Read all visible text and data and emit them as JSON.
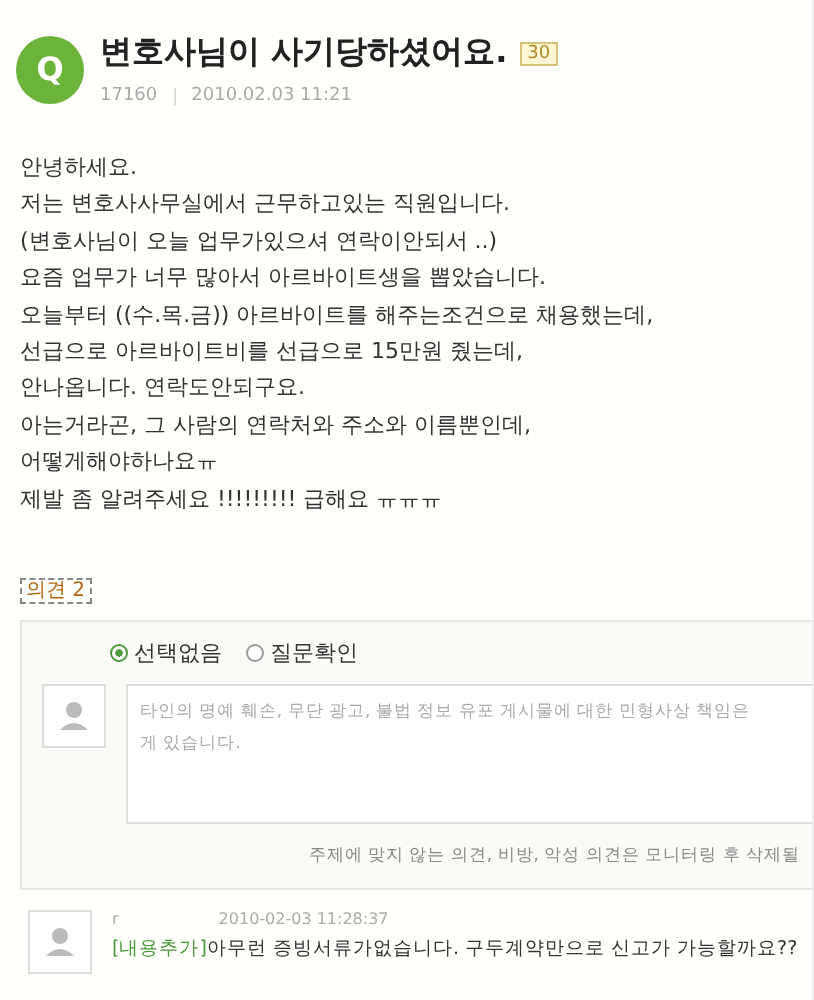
{
  "question": {
    "badge": "Q",
    "title": "변호사님이 사기당하셨어요.",
    "points": "30",
    "author": "17160",
    "date": "2010.02.03 11:21"
  },
  "body": [
    "안녕하세요.",
    "저는 변호사사무실에서 근무하고있는 직원입니다.",
    "(변호사님이 오늘 업무가있으셔 연락이안되서 ..)",
    "요즘 업무가 너무 많아서 아르바이트생을 뽑았습니다.",
    "오늘부터 ((수.목.금)) 아르바이트를 해주는조건으로 채용했는데,",
    "선급으로 아르바이트비를 선급으로 15만원 줬는데,",
    "안나옵니다. 연락도안되구요.",
    "아는거라곤, 그 사람의 연락처와 주소와 이름뿐인데,",
    "어떻게해야하나요ㅠ",
    "제발 좀 알려주세요 !!!!!!!!! 급해요 ㅠㅠㅠ"
  ],
  "comments_heading": "의견 2",
  "comment_form": {
    "options": [
      {
        "label": "선택없음",
        "selected": true
      },
      {
        "label": "질문확인",
        "selected": false
      }
    ],
    "placeholder_lines": [
      "타인의 명예 훼손, 무단 광고, 불법 정보 유포 게시물에 대한 민형사상 책임은",
      "게 있습니다."
    ],
    "note": "주제에 맞지 않는 의견, 비방, 악성 의견은 모니터링 후 삭제될"
  },
  "comments": [
    {
      "author": "r",
      "date": "2010-02-03 11:28:37",
      "tag": "[내용추가]",
      "text": "아무런 증빙서류가없습니다. 구두계약만으로 신고가 가능할까요??"
    }
  ]
}
